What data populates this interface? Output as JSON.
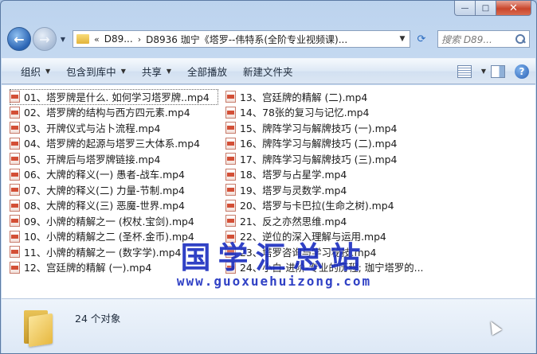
{
  "titlebar": {
    "minimize": "—",
    "maximize": "□",
    "close": "✕"
  },
  "address": {
    "overflow": "«",
    "crumbs": [
      "D89...",
      "D8936 珈宁《塔罗--伟特系(全阶专业视频课)..."
    ],
    "separator": "›"
  },
  "search": {
    "placeholder": "搜索 D89..."
  },
  "toolbar": {
    "organize": "组织",
    "include_in_library": "包含到库中",
    "share": "共享",
    "play_all": "全部播放",
    "new_folder": "新建文件夹"
  },
  "files": [
    "01、塔罗牌是什么. 如何学习塔罗牌..mp4",
    "02、塔罗牌的结构与西方四元素.mp4",
    "03、开牌仪式与沾卜流程.mp4",
    "04、塔罗牌的起源与塔罗三大体系.mp4",
    "05、开牌后与塔罗牌链接.mp4",
    "06、大牌的释义(一) 愚者-战车.mp4",
    "07、大牌的释义(二) 力量-节制.mp4",
    "08、大牌的释义(三) 恶魔-世界.mp4",
    "09、小牌的精解之一 (权杖.宝剑).mp4",
    "10、小牌的精解之二 (圣杯.金币).mp4",
    "11、小牌的精解之一 (数字学).mp4",
    "12、宫廷牌的精解 (一).mp4",
    "13、宫廷牌的精解 (二).mp4",
    "14、78张的复习与记忆.mp4",
    "15、牌阵学习与解牌技巧 (一).mp4",
    "16、牌阵学习与解牌技巧 (二).mp4",
    "17、牌阵学习与解牌技巧 (三).mp4",
    "18、塔罗与占星学.mp4",
    "19、塔罗与灵数学.mp4",
    "20、塔罗与卡巴拉(生命之树).mp4",
    "21、反之亦然思维.mp4",
    "22、逆位的深入理解与运用.mp4",
    "23、塔罗咨询与学习秘技.mp4",
    "24、小白-进阶-专业的历程; 珈宁塔罗的..."
  ],
  "watermark": {
    "text": "国学汇总站",
    "url": "www.guoxuehuizong.com"
  },
  "status": {
    "count": "24 个对象"
  }
}
